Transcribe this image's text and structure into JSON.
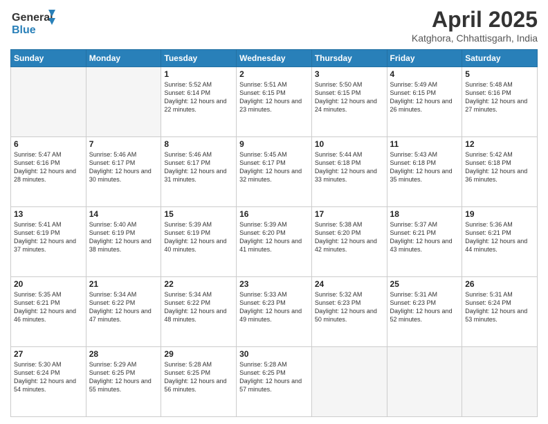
{
  "header": {
    "logo_line1": "General",
    "logo_line2": "Blue",
    "main_title": "April 2025",
    "subtitle": "Katghora, Chhattisgarh, India"
  },
  "days_of_week": [
    "Sunday",
    "Monday",
    "Tuesday",
    "Wednesday",
    "Thursday",
    "Friday",
    "Saturday"
  ],
  "weeks": [
    [
      {
        "day": "",
        "detail": ""
      },
      {
        "day": "",
        "detail": ""
      },
      {
        "day": "1",
        "detail": "Sunrise: 5:52 AM\nSunset: 6:14 PM\nDaylight: 12 hours and 22 minutes."
      },
      {
        "day": "2",
        "detail": "Sunrise: 5:51 AM\nSunset: 6:15 PM\nDaylight: 12 hours and 23 minutes."
      },
      {
        "day": "3",
        "detail": "Sunrise: 5:50 AM\nSunset: 6:15 PM\nDaylight: 12 hours and 24 minutes."
      },
      {
        "day": "4",
        "detail": "Sunrise: 5:49 AM\nSunset: 6:15 PM\nDaylight: 12 hours and 26 minutes."
      },
      {
        "day": "5",
        "detail": "Sunrise: 5:48 AM\nSunset: 6:16 PM\nDaylight: 12 hours and 27 minutes."
      }
    ],
    [
      {
        "day": "6",
        "detail": "Sunrise: 5:47 AM\nSunset: 6:16 PM\nDaylight: 12 hours and 28 minutes."
      },
      {
        "day": "7",
        "detail": "Sunrise: 5:46 AM\nSunset: 6:17 PM\nDaylight: 12 hours and 30 minutes."
      },
      {
        "day": "8",
        "detail": "Sunrise: 5:46 AM\nSunset: 6:17 PM\nDaylight: 12 hours and 31 minutes."
      },
      {
        "day": "9",
        "detail": "Sunrise: 5:45 AM\nSunset: 6:17 PM\nDaylight: 12 hours and 32 minutes."
      },
      {
        "day": "10",
        "detail": "Sunrise: 5:44 AM\nSunset: 6:18 PM\nDaylight: 12 hours and 33 minutes."
      },
      {
        "day": "11",
        "detail": "Sunrise: 5:43 AM\nSunset: 6:18 PM\nDaylight: 12 hours and 35 minutes."
      },
      {
        "day": "12",
        "detail": "Sunrise: 5:42 AM\nSunset: 6:18 PM\nDaylight: 12 hours and 36 minutes."
      }
    ],
    [
      {
        "day": "13",
        "detail": "Sunrise: 5:41 AM\nSunset: 6:19 PM\nDaylight: 12 hours and 37 minutes."
      },
      {
        "day": "14",
        "detail": "Sunrise: 5:40 AM\nSunset: 6:19 PM\nDaylight: 12 hours and 38 minutes."
      },
      {
        "day": "15",
        "detail": "Sunrise: 5:39 AM\nSunset: 6:19 PM\nDaylight: 12 hours and 40 minutes."
      },
      {
        "day": "16",
        "detail": "Sunrise: 5:39 AM\nSunset: 6:20 PM\nDaylight: 12 hours and 41 minutes."
      },
      {
        "day": "17",
        "detail": "Sunrise: 5:38 AM\nSunset: 6:20 PM\nDaylight: 12 hours and 42 minutes."
      },
      {
        "day": "18",
        "detail": "Sunrise: 5:37 AM\nSunset: 6:21 PM\nDaylight: 12 hours and 43 minutes."
      },
      {
        "day": "19",
        "detail": "Sunrise: 5:36 AM\nSunset: 6:21 PM\nDaylight: 12 hours and 44 minutes."
      }
    ],
    [
      {
        "day": "20",
        "detail": "Sunrise: 5:35 AM\nSunset: 6:21 PM\nDaylight: 12 hours and 46 minutes."
      },
      {
        "day": "21",
        "detail": "Sunrise: 5:34 AM\nSunset: 6:22 PM\nDaylight: 12 hours and 47 minutes."
      },
      {
        "day": "22",
        "detail": "Sunrise: 5:34 AM\nSunset: 6:22 PM\nDaylight: 12 hours and 48 minutes."
      },
      {
        "day": "23",
        "detail": "Sunrise: 5:33 AM\nSunset: 6:23 PM\nDaylight: 12 hours and 49 minutes."
      },
      {
        "day": "24",
        "detail": "Sunrise: 5:32 AM\nSunset: 6:23 PM\nDaylight: 12 hours and 50 minutes."
      },
      {
        "day": "25",
        "detail": "Sunrise: 5:31 AM\nSunset: 6:23 PM\nDaylight: 12 hours and 52 minutes."
      },
      {
        "day": "26",
        "detail": "Sunrise: 5:31 AM\nSunset: 6:24 PM\nDaylight: 12 hours and 53 minutes."
      }
    ],
    [
      {
        "day": "27",
        "detail": "Sunrise: 5:30 AM\nSunset: 6:24 PM\nDaylight: 12 hours and 54 minutes."
      },
      {
        "day": "28",
        "detail": "Sunrise: 5:29 AM\nSunset: 6:25 PM\nDaylight: 12 hours and 55 minutes."
      },
      {
        "day": "29",
        "detail": "Sunrise: 5:28 AM\nSunset: 6:25 PM\nDaylight: 12 hours and 56 minutes."
      },
      {
        "day": "30",
        "detail": "Sunrise: 5:28 AM\nSunset: 6:25 PM\nDaylight: 12 hours and 57 minutes."
      },
      {
        "day": "",
        "detail": ""
      },
      {
        "day": "",
        "detail": ""
      },
      {
        "day": "",
        "detail": ""
      }
    ]
  ]
}
